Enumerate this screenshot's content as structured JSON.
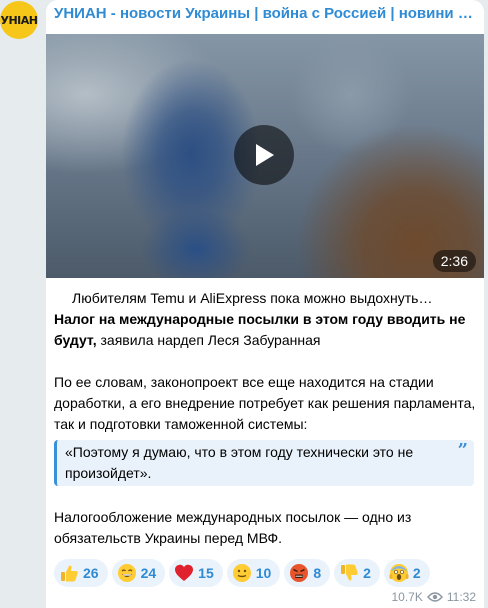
{
  "avatar": {
    "text": "УНIAН",
    "bg_color": "#f6c619"
  },
  "channel": {
    "title": "УНИАН - новости Украины | война с Россией | новини України…",
    "title_color": "#2f8bd4"
  },
  "video": {
    "duration": "2:36",
    "play_icon": "play-icon"
  },
  "post": {
    "intro": "Любителям Temu и AliExpress пока можно выдохнуть…",
    "bold_lead": "Налог на международные посылки в этом году вводить не будут,",
    "lead_rest": " заявила нардеп Леся Забуранная",
    "paragraph2": "По ее словам, законопроект все еще находится на стадии доработки, а его внедрение потребует как решения парламента, так и подготовки таможенной системы:",
    "quote": "«Поэтому я думаю, что в этом году технически это не произойдет».",
    "quote_icon": "quote-icon",
    "paragraph3": "Налогообложение международных посылок — одно из обязательств Украины перед МВФ."
  },
  "reactions": [
    {
      "icon": "thumbs-up-icon",
      "count": "26"
    },
    {
      "icon": "grinning-face-icon",
      "count": "24"
    },
    {
      "icon": "red-heart-icon",
      "count": "15"
    },
    {
      "icon": "smiling-face-icon",
      "count": "10"
    },
    {
      "icon": "angry-face-icon",
      "count": "8"
    },
    {
      "icon": "thumbs-down-icon",
      "count": "2"
    },
    {
      "icon": "screaming-face-icon",
      "count": "2"
    }
  ],
  "meta": {
    "views": "10.7K",
    "time": "11:32",
    "eye_icon": "eye-icon"
  }
}
